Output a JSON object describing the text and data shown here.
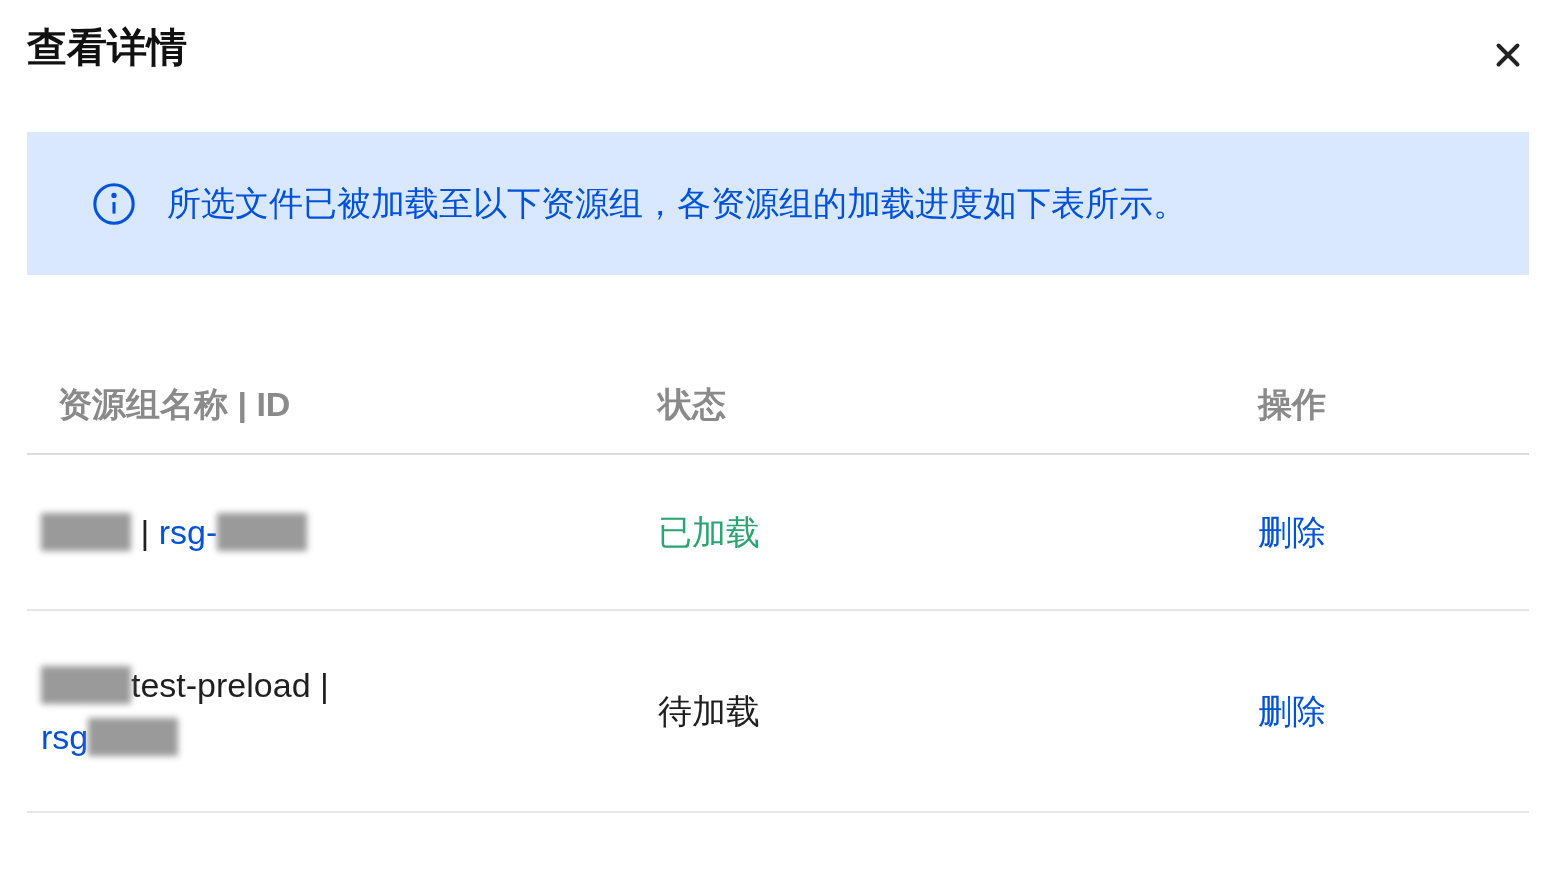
{
  "dialog": {
    "title": "查看详情"
  },
  "notice": {
    "text": "所选文件已被加载至以下资源组，各资源组的加载进度如下表所示。"
  },
  "table": {
    "columns": [
      "资源组名称 | ID",
      "状态",
      "操作"
    ],
    "rows": [
      {
        "name_lines": [
          [
            {
              "kind": "redacted"
            },
            {
              "kind": "text",
              "text": " | "
            },
            {
              "kind": "link",
              "text": "rsg-"
            },
            {
              "kind": "redacted"
            }
          ]
        ],
        "status": {
          "kind": "loaded",
          "text": "已加载"
        },
        "action": "删除"
      },
      {
        "name_lines": [
          [
            {
              "kind": "redacted"
            },
            {
              "kind": "text",
              "text": "test-preload |"
            }
          ],
          [
            {
              "kind": "link",
              "text": "rsg"
            },
            {
              "kind": "redacted"
            }
          ]
        ],
        "status": {
          "kind": "pending",
          "text": "待加载"
        },
        "action": "删除"
      }
    ]
  }
}
